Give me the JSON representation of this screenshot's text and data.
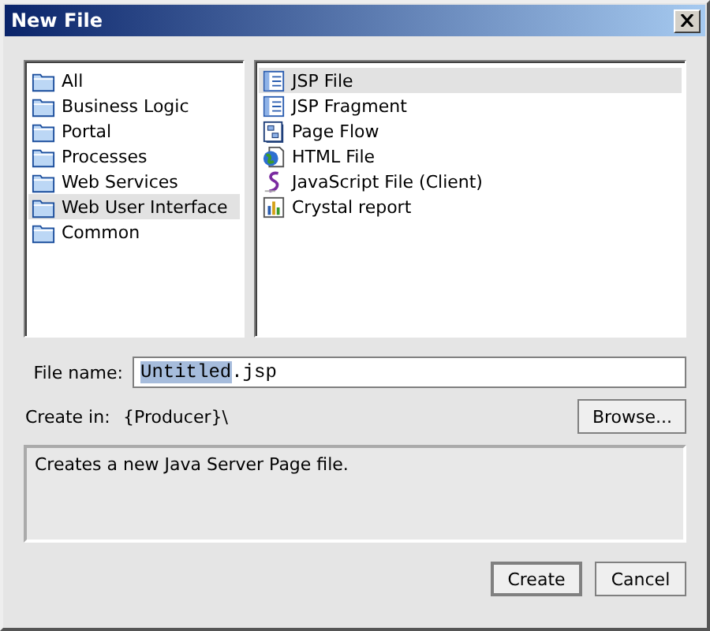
{
  "window": {
    "title": "New File"
  },
  "categories": [
    {
      "label": "All",
      "selected": false
    },
    {
      "label": "Business Logic",
      "selected": false
    },
    {
      "label": "Portal",
      "selected": false
    },
    {
      "label": "Processes",
      "selected": false
    },
    {
      "label": "Web Services",
      "selected": false
    },
    {
      "label": "Web User Interface",
      "selected": true
    },
    {
      "label": "Common",
      "selected": false
    }
  ],
  "templates": [
    {
      "label": "JSP File",
      "kind": "jsp",
      "selected": true
    },
    {
      "label": "JSP Fragment",
      "kind": "jsp",
      "selected": false
    },
    {
      "label": "Page Flow",
      "kind": "flow",
      "selected": false
    },
    {
      "label": "HTML File",
      "kind": "html",
      "selected": false
    },
    {
      "label": "JavaScript File (Client)",
      "kind": "script",
      "selected": false
    },
    {
      "label": "Crystal report",
      "kind": "report",
      "selected": false
    }
  ],
  "file_name": {
    "label": "File name:",
    "value_parts": [
      {
        "text": "Untitled",
        "selected": true
      },
      {
        "text": ".jsp",
        "selected": false
      }
    ]
  },
  "create_in": {
    "label": "Create in:",
    "value": "{Producer}\\"
  },
  "browse_button": "Browse...",
  "description": "Creates a new Java Server Page file.",
  "buttons": [
    "Create",
    "Cancel"
  ]
}
